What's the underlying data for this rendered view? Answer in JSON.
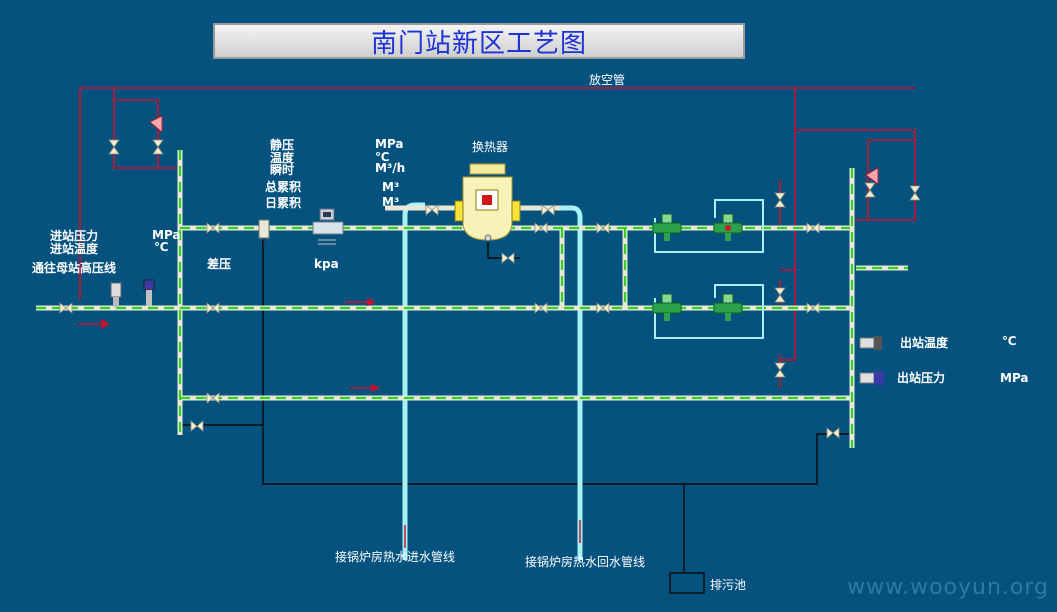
{
  "title": "南门站新区工艺图",
  "labels": {
    "vent_pipe": "放空管",
    "inlet_pressure": "进站压力",
    "inlet_temperature": "进站温度",
    "to_mother_station": "通往母站高压线",
    "inlet_pressure_unit": "MPa",
    "inlet_temp_symbol": "℃",
    "diff_pressure": "差压",
    "static_pressure": "静压",
    "temperature": "温度",
    "instant": "瞬时",
    "total_cumulative": "总累积",
    "daily_cumulative": "日累积",
    "kpa_unit": "kpa",
    "flow_pressure_unit": "MPa",
    "flow_temp_symbol": "℃",
    "flow_instant_unit": "M³/h",
    "flow_total_unit": "M³",
    "flow_daily_unit": "M³",
    "heat_exchanger": "换热器",
    "outlet_temperature": "出站温度",
    "outlet_temp_symbol": "℃",
    "outlet_pressure": "出站压力",
    "outlet_pressure_unit": "MPa",
    "boiler_supply_line": "接锅炉房热水进水管线",
    "boiler_return_line": "接锅炉房热水回水管线",
    "sewage_pool": "排污池"
  },
  "watermark": "www.wooyun.org",
  "colors": {
    "background": "#05527f",
    "gas_pipe": "#e9e7d6",
    "gas_pipe_dash": "#32d324",
    "water_pipe": "#a9f1f5",
    "vent_line": "#c8102e",
    "drain_line": "#0a0a0a",
    "valve": "#e9e7c8",
    "title_text": "#1d33d6"
  }
}
